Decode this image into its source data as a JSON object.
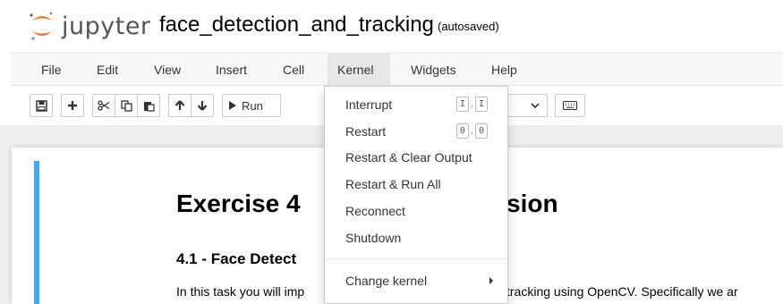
{
  "header": {
    "logo_text": "jupyter",
    "notebook_title": "face_detection_and_tracking",
    "autosave_status": "(autosaved)"
  },
  "menubar": {
    "items": [
      "File",
      "Edit",
      "View",
      "Insert",
      "Cell",
      "Kernel",
      "Widgets",
      "Help"
    ],
    "open_menu": "Kernel"
  },
  "toolbar": {
    "buttons": [
      "save-icon",
      "plus-icon",
      "scissors-icon",
      "copy-icon",
      "paste-icon",
      "arrow-up-icon",
      "arrow-down-icon",
      "run-icon",
      "chevron-down-icon",
      "keyboard-icon"
    ],
    "run_label": "Run"
  },
  "kernel_menu": {
    "interrupt": {
      "label": "Interrupt",
      "shortcut": [
        "I",
        "I"
      ]
    },
    "restart": {
      "label": "Restart",
      "shortcut": [
        "0",
        "0"
      ]
    },
    "restart_clear": {
      "label": "Restart & Clear Output"
    },
    "restart_run_all": {
      "label": "Restart & Run All"
    },
    "reconnect": {
      "label": "Reconnect"
    },
    "shutdown": {
      "label": "Shutdown"
    },
    "change_kernel": {
      "label": "Change kernel"
    },
    "shortcut_separator": ","
  },
  "notebook": {
    "heading1_left": "Exercise 4",
    "heading1_right": "sion",
    "heading2": "4.1 - Face Detect",
    "paragraph_left": "In this task you will imp",
    "paragraph_right": "tracking using OpenCV. Specifically we ar"
  },
  "colors": {
    "cell_selected_bar": "#42a5f5",
    "logo_orange": "#f37726",
    "menubar_bg": "#f8f8f8",
    "notebook_bg": "#eeeeee"
  }
}
